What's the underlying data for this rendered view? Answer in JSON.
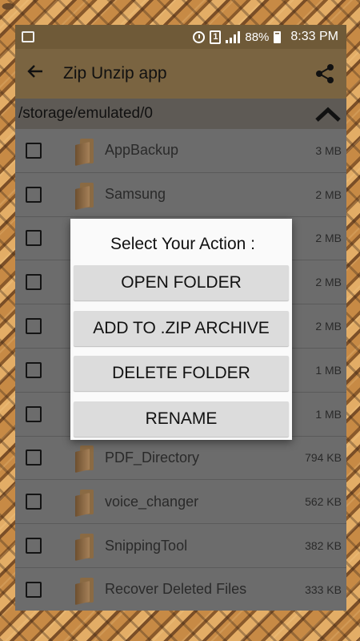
{
  "status_bar": {
    "battery": "88%",
    "time": "8:33 PM",
    "sim": "1"
  },
  "app_bar": {
    "title": "Zip Unzip app"
  },
  "path": "/storage/emulated/0",
  "files": [
    {
      "name": "AppBackup",
      "size": "3 MB"
    },
    {
      "name": "Samsung",
      "size": "2 MB"
    },
    {
      "name": "",
      "size": "2 MB"
    },
    {
      "name": "",
      "size": "2 MB"
    },
    {
      "name": "",
      "size": "2 MB"
    },
    {
      "name": "",
      "size": "1 MB"
    },
    {
      "name": "",
      "size": "1 MB"
    },
    {
      "name": "PDF_Directory",
      "size": "794 KB"
    },
    {
      "name": "voice_changer",
      "size": "562 KB"
    },
    {
      "name": "SnippingTool",
      "size": "382 KB"
    },
    {
      "name": "Recover Deleted Files",
      "size": "333 KB"
    }
  ],
  "dialog": {
    "title": "Select Your Action :",
    "buttons": {
      "open": "OPEN FOLDER",
      "add_zip": "ADD TO .ZIP ARCHIVE",
      "delete": "DELETE FOLDER",
      "rename": "RENAME"
    }
  }
}
